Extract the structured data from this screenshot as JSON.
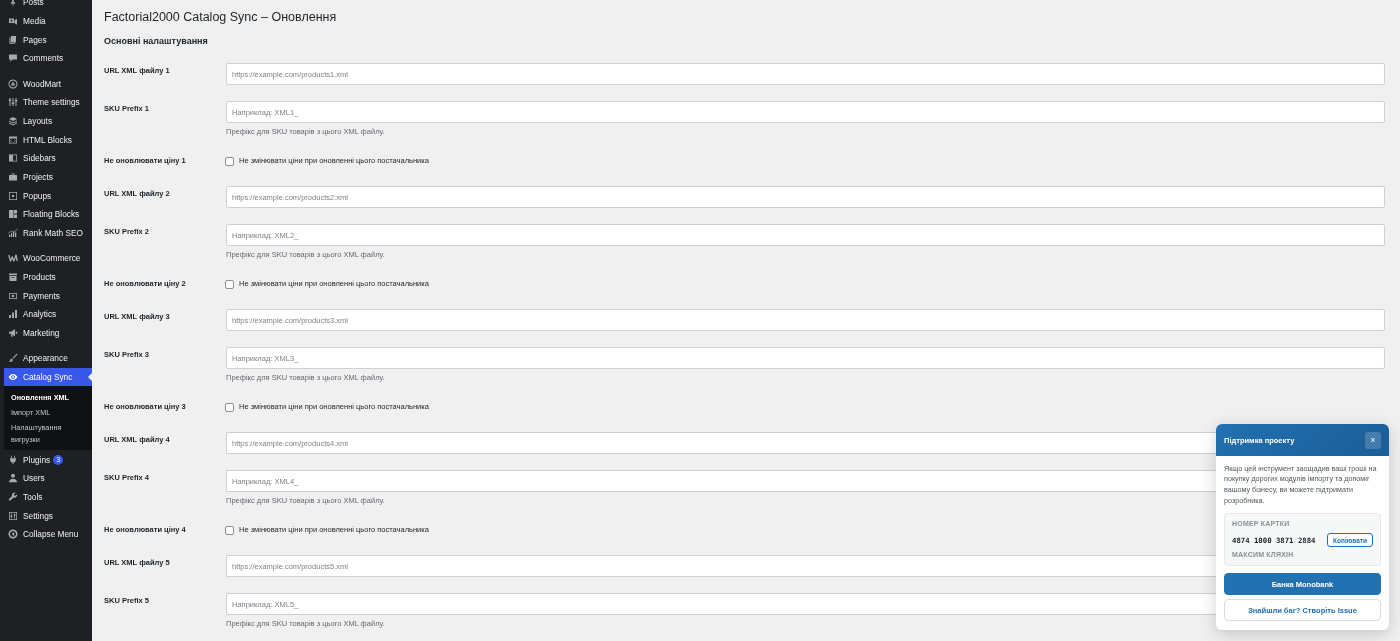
{
  "sidebar": {
    "groups": [
      {
        "items": [
          {
            "label": "Posts",
            "selected": false
          },
          {
            "label": "Media",
            "selected": false
          },
          {
            "label": "Pages",
            "selected": false
          },
          {
            "label": "Comments",
            "selected": false
          }
        ]
      },
      {
        "items": [
          {
            "label": "WoodMart",
            "selected": false
          },
          {
            "label": "Theme settings",
            "selected": false
          },
          {
            "label": "Layouts",
            "selected": false
          },
          {
            "label": "HTML Blocks",
            "selected": false
          },
          {
            "label": "Sidebars",
            "selected": false
          },
          {
            "label": "Projects",
            "selected": false
          },
          {
            "label": "Popups",
            "selected": false
          },
          {
            "label": "Floating Blocks",
            "selected": false
          },
          {
            "label": "Rank Math SEO",
            "selected": false
          }
        ]
      },
      {
        "items": [
          {
            "label": "WooCommerce",
            "selected": false
          },
          {
            "label": "Products",
            "selected": false
          },
          {
            "label": "Payments",
            "selected": false
          },
          {
            "label": "Analytics",
            "selected": false
          },
          {
            "label": "Marketing",
            "selected": false
          }
        ]
      },
      {
        "items": [
          {
            "label": "Appearance",
            "selected": false
          },
          {
            "label": "Catalog Sync",
            "selected": true,
            "children": [
              {
                "label": "Оновлення XML",
                "selected": true
              },
              {
                "label": "Імпорт XML",
                "selected": false
              },
              {
                "label": "Налаштування вигрузки",
                "selected": false
              }
            ]
          },
          {
            "label": "Plugins",
            "selected": false,
            "badge": "3"
          },
          {
            "label": "Users",
            "selected": false
          },
          {
            "label": "Tools",
            "selected": false
          },
          {
            "label": "Settings",
            "selected": false
          },
          {
            "label": "Collapse Menu",
            "selected": false
          }
        ]
      }
    ]
  },
  "page": {
    "title": "Factorial2000 Catalog Sync – Оновлення",
    "section_heading": "Основні налаштування"
  },
  "rows": [
    {
      "kind": "field",
      "label": "URL XML файлу 1",
      "placeholder": "https://example.com/products1.xml"
    },
    {
      "kind": "field",
      "label": "SKU Prefix 1",
      "placeholder": "Наприклад: XML1_",
      "description": "Префікс для SKU товарів з цього XML файлу."
    },
    {
      "kind": "checkbox",
      "label": "Не оновлювати ціну 1",
      "option": "Не змінювати ціни при оновленні цього постачальника",
      "checked": false
    },
    {
      "kind": "field",
      "label": "URL XML файлу 2",
      "placeholder": "https://example.com/products2.xml"
    },
    {
      "kind": "field",
      "label": "SKU Prefix 2",
      "placeholder": "Наприклад: XML2_",
      "description": "Префікс для SKU товарів з цього XML файлу."
    },
    {
      "kind": "checkbox",
      "label": "Не оновлювати ціну 2",
      "option": "Не змінювати ціни при оновленні цього постачальника",
      "checked": false
    },
    {
      "kind": "field",
      "label": "URL XML файлу 3",
      "placeholder": "https://example.com/products3.xml"
    },
    {
      "kind": "field",
      "label": "SKU Prefix 3",
      "placeholder": "Наприклад: XML3_",
      "description": "Префікс для SKU товарів з цього XML файлу."
    },
    {
      "kind": "checkbox",
      "label": "Не оновлювати ціну 3",
      "option": "Не змінювати ціни при оновленні цього постачальника",
      "checked": false
    },
    {
      "kind": "field",
      "label": "URL XML файлу 4",
      "placeholder": "https://example.com/products4.xml"
    },
    {
      "kind": "field",
      "label": "SKU Prefix 4",
      "placeholder": "Наприклад: XML4_",
      "description": "Префікс для SKU товарів з цього XML файлу."
    },
    {
      "kind": "checkbox",
      "label": "Не оновлювати ціну 4",
      "option": "Не змінювати ціни при оновленні цього постачальника",
      "checked": false
    },
    {
      "kind": "field",
      "label": "URL XML файлу 5",
      "placeholder": "https://example.com/products5.xml"
    },
    {
      "kind": "field",
      "label": "SKU Prefix 5",
      "placeholder": "Наприклад: XML5_",
      "description": "Префікс для SKU товарів з цього XML файлу."
    }
  ],
  "support_popup": {
    "title": "Підтримка проекту",
    "close": "×",
    "message": "Якщо цей інструмент заощадив ваші гроші на покупку дорогих модулів імпорту та допоміг вашому бізнесу, ви можете підтримати розробника.",
    "card": {
      "label": "НОМЕР КАРТКИ",
      "number": "4874 1000 3871 2884",
      "copy_button": "Копіювати",
      "holder": "МАКСИМ КЛЯХІН"
    },
    "buttons": [
      {
        "kind": "primary",
        "label": "Банка Monobank"
      },
      {
        "kind": "secondary",
        "label": "Знайшли баг? Створіть Issue"
      }
    ]
  }
}
